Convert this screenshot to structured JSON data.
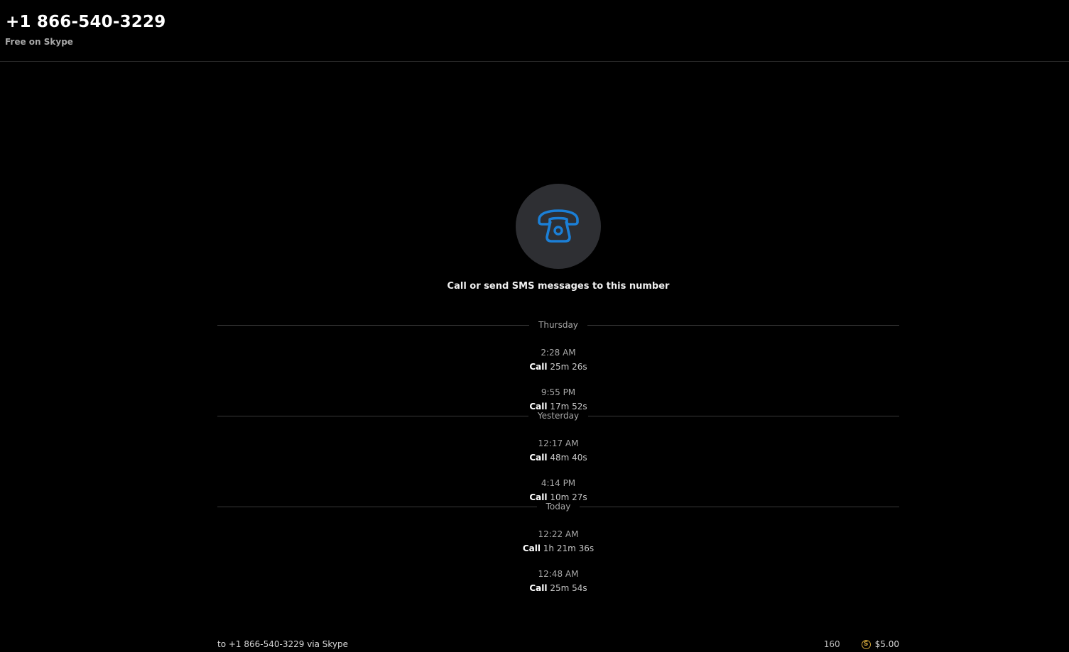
{
  "header": {
    "title": "+1 866-540-3229",
    "subtitle": "Free on Skype"
  },
  "hero": {
    "icon": "phone-icon",
    "caption": "Call or send SMS messages to this number",
    "icon_color": "#1b7fd6",
    "circle_color": "#2e2f33"
  },
  "timeline": [
    {
      "day": "Thursday",
      "calls": [
        {
          "time": "2:28 AM",
          "label": "Call",
          "duration": "25m 26s"
        },
        {
          "time": "9:55 PM",
          "label": "Call",
          "duration": "17m 52s"
        }
      ]
    },
    {
      "day": "Yesterday",
      "calls": [
        {
          "time": "12:17 AM",
          "label": "Call",
          "duration": "48m 40s"
        },
        {
          "time": "4:14 PM",
          "label": "Call",
          "duration": "10m 27s"
        }
      ]
    },
    {
      "day": "Today",
      "calls": [
        {
          "time": "12:22 AM",
          "label": "Call",
          "duration": "1h 21m 36s"
        },
        {
          "time": "12:48 AM",
          "label": "Call",
          "duration": "25m 54s"
        }
      ]
    }
  ],
  "footer": {
    "sms_target": "to +1 866-540-3229 via Skype",
    "char_count": "160",
    "credit_icon": "skype-credit-icon",
    "credit_balance": "$5.00"
  }
}
